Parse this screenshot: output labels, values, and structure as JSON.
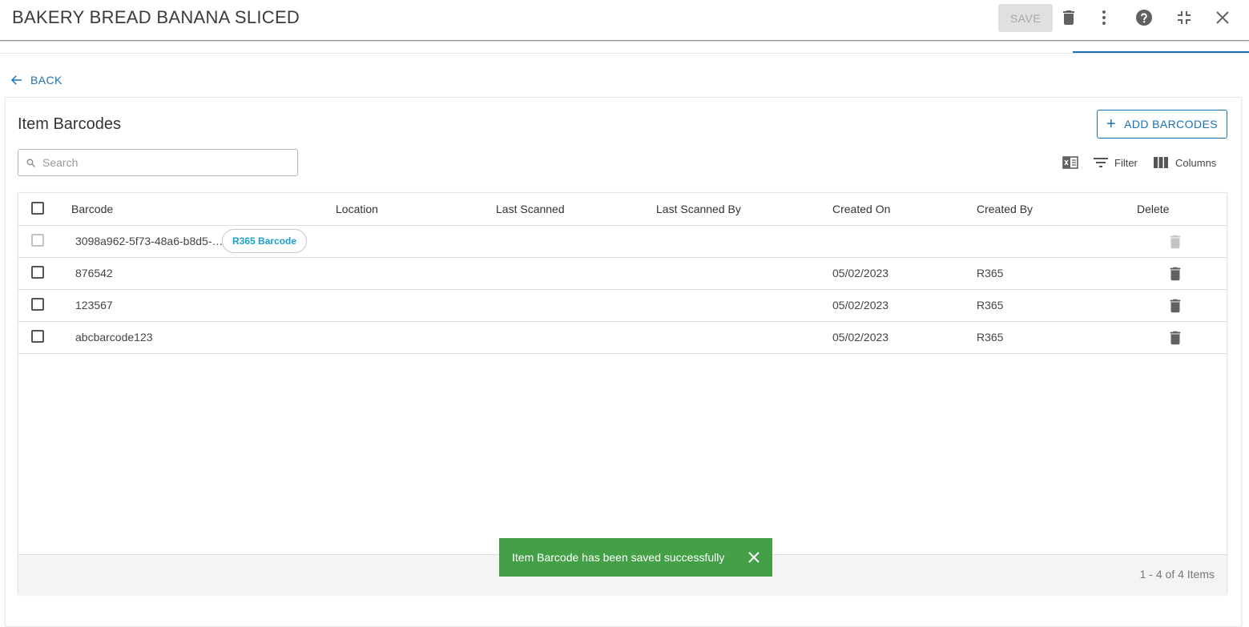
{
  "header": {
    "title": "BAKERY BREAD BANANA SLICED",
    "save_label": "SAVE",
    "icons": [
      "trash-icon",
      "more-vert-icon",
      "help-icon",
      "collapse-icon",
      "close-icon"
    ]
  },
  "nav": {
    "back_label": "BACK"
  },
  "section": {
    "title": "Item Barcodes",
    "add_label": "ADD BARCODES"
  },
  "search": {
    "placeholder": "Search",
    "value": ""
  },
  "toolbar": {
    "filter_label": "Filter",
    "columns_label": "Columns",
    "export_icon": "excel-export-icon"
  },
  "table": {
    "columns": [
      "Barcode",
      "Location",
      "Last Scanned",
      "Last Scanned By",
      "Created On",
      "Created By",
      "Delete"
    ],
    "rows": [
      {
        "barcode": "3098a962-5f73-48a6-b8d5-…",
        "chip": "R365 Barcode",
        "location": "",
        "last_scanned": "",
        "last_scanned_by": "",
        "created_on": "",
        "created_by": "",
        "disabled": true
      },
      {
        "barcode": "876542",
        "location": "",
        "last_scanned": "",
        "last_scanned_by": "",
        "created_on": "05/02/2023",
        "created_by": "R365",
        "disabled": false
      },
      {
        "barcode": "123567",
        "location": "",
        "last_scanned": "",
        "last_scanned_by": "",
        "created_on": "05/02/2023",
        "created_by": "R365",
        "disabled": false
      },
      {
        "barcode": "abcbarcode123",
        "location": "",
        "last_scanned": "",
        "last_scanned_by": "",
        "created_on": "05/02/2023",
        "created_by": "R365",
        "disabled": false
      }
    ],
    "pager_text": "1 - 4 of 4 Items"
  },
  "toast": {
    "message": "Item Barcode has been saved successfully",
    "color": "#43a047"
  },
  "colors": {
    "accent": "#1a73b8",
    "chip_text": "#1a9fd0"
  }
}
